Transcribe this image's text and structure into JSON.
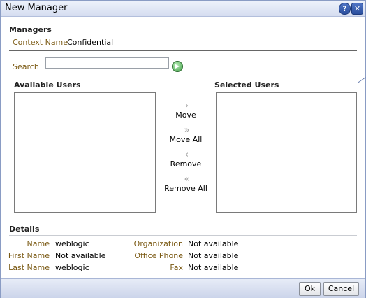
{
  "window": {
    "title": "New Manager"
  },
  "managers": {
    "heading": "Managers",
    "context_name_label": "Context Name",
    "context_name_value": "Confidential"
  },
  "search": {
    "label": "Search",
    "value": "",
    "placeholder": ""
  },
  "available_users": {
    "heading": "Available Users",
    "items": []
  },
  "selected_users": {
    "heading": "Selected Users",
    "items": []
  },
  "shuttle": {
    "move": "Move",
    "move_all": "Move All",
    "remove": "Remove",
    "remove_all": "Remove All"
  },
  "details": {
    "heading": "Details",
    "name_label": "Name",
    "name_value": "weblogic",
    "first_name_label": "First Name",
    "first_name_value": "Not available",
    "last_name_label": "Last Name",
    "last_name_value": "weblogic",
    "organization_label": "Organization",
    "organization_value": "Not available",
    "office_phone_label": "Office Phone",
    "office_phone_value": "Not available",
    "fax_label": "Fax",
    "fax_value": "Not available"
  },
  "buttons": {
    "ok_label": "Ok",
    "ok_mnemonic": "O",
    "ok_rest": "k",
    "cancel_label": "Cancel",
    "cancel_mnemonic": "C",
    "cancel_rest": "ancel"
  },
  "colors": {
    "label_text": "#7b5a14",
    "titlebar": "#d5ddf0",
    "footer": "#cbd4ea",
    "accent": "#2b4f9e"
  },
  "icons": {
    "help": "help-icon",
    "close": "close-icon",
    "go": "go-icon",
    "move": "chevron-right-icon",
    "move_all": "double-chevron-right-icon",
    "remove": "chevron-left-icon",
    "remove_all": "double-chevron-left-icon"
  }
}
